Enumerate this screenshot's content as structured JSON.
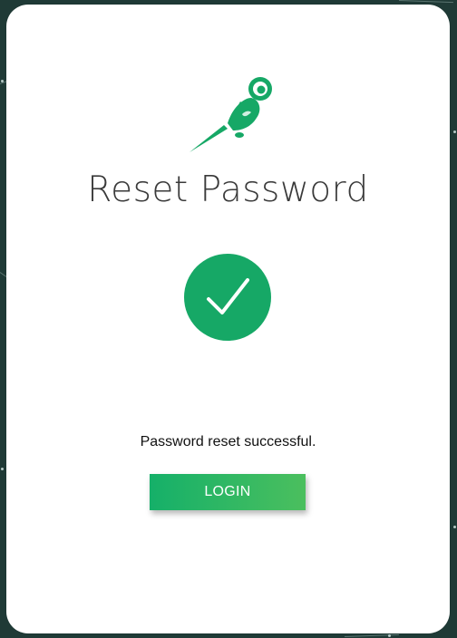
{
  "page": {
    "title": "Reset Password",
    "message": "Password reset successful.",
    "login_label": "LOGIN"
  },
  "icons": {
    "logo": "rocket-astronaut-logo-icon",
    "status": "check-circle-icon"
  },
  "colors": {
    "background": "#1f3a36",
    "card": "#ffffff",
    "accent": "#16a866",
    "button_gradient_start": "#15b069",
    "button_gradient_end": "#4bbf5e",
    "title_text": "#3a3a3a"
  }
}
